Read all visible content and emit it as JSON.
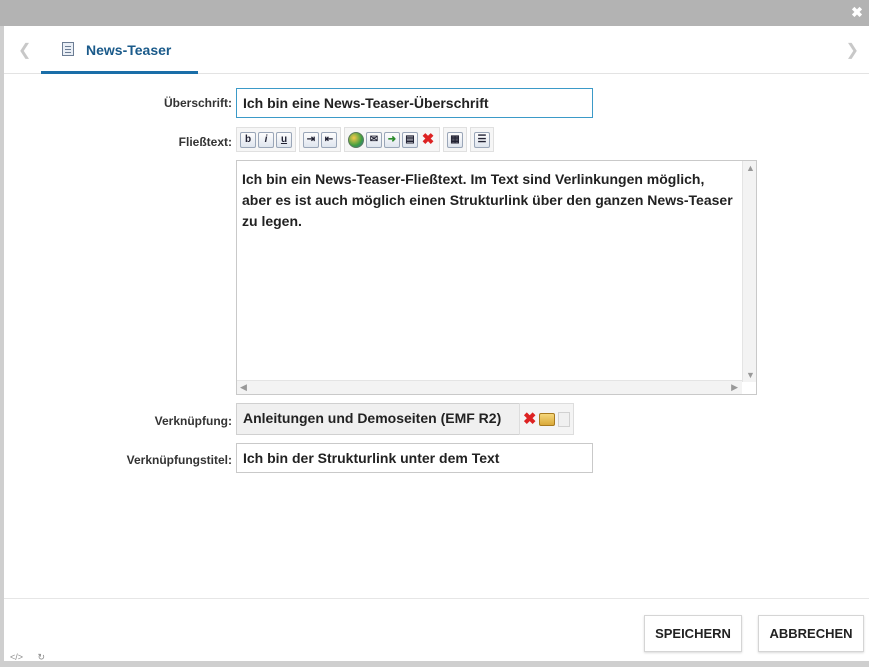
{
  "window": {
    "close_icon": "close-icon"
  },
  "tabs": {
    "prev_icon": "chevron-left-icon",
    "next_icon": "chevron-right-icon",
    "active": {
      "label": "News-Teaser",
      "icon": "document-icon"
    }
  },
  "form": {
    "headline": {
      "label": "Überschrift:",
      "value": "Ich bin eine News-Teaser-Überschrift"
    },
    "body": {
      "label": "Fließtext:",
      "value": "Ich bin ein News-Teaser-Fließtext. Im Text sind Verlinkungen möglich, aber es ist auch möglich einen Strukturlink über den ganzen News-Teaser zu legen."
    },
    "link": {
      "label": "Verknüpfung:",
      "value": "Anleitungen und Demoseiten (EMF R2)"
    },
    "link_title": {
      "label": "Verknüpfungstitel:",
      "value": "Ich bin der Strukturlink unter dem Text"
    }
  },
  "toolbar": {
    "bold": "b",
    "italic": "i",
    "underline": "u"
  },
  "actions": {
    "save_label": "SPEICHERN",
    "cancel_label": "ABBRECHEN"
  },
  "status": {
    "code_icon": "</>",
    "refresh_icon": "↻"
  },
  "colors": {
    "accent": "#1a6ea8",
    "focus_border": "#3b9ac8",
    "delete_red": "#d22222"
  }
}
